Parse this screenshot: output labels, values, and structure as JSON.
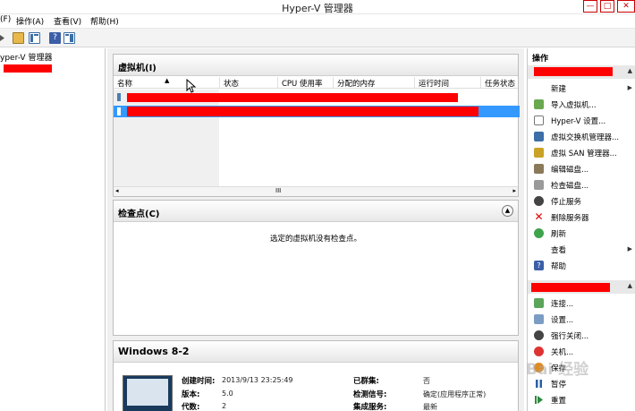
{
  "window": {
    "title": "Hyper-V 管理器",
    "controls": [
      "—",
      "□",
      "✕"
    ]
  },
  "menu": [
    "(F)",
    "操作(A)",
    "查看(V)",
    "帮助(H)"
  ],
  "tree": {
    "root_label": "yper-V 管理器"
  },
  "vm_panel": {
    "title": "虚拟机(I)",
    "columns": [
      "名称",
      "状态",
      "CPU 使用率",
      "分配的内存",
      "运行时间",
      "任务状态"
    ],
    "scroll_mark": "III"
  },
  "checkpoint_panel": {
    "title": "检查点(C)",
    "empty_message": "选定的虚拟机没有检查点。"
  },
  "details_panel": {
    "title": "Windows 8-2",
    "left_fields": [
      {
        "label": "创建时间:",
        "value": "2013/9/13 23:25:49"
      },
      {
        "label": "版本:",
        "value": "5.0"
      },
      {
        "label": "代数:",
        "value": "2"
      }
    ],
    "right_fields": [
      {
        "label": "已群集:",
        "value": "否"
      },
      {
        "label": "检测信号:",
        "value": "确定(应用程序正常)"
      },
      {
        "label": "集成服务:",
        "value": "最新"
      }
    ]
  },
  "actions_pane": {
    "header": "操作",
    "host_items": [
      {
        "label": "新建",
        "icon": "none",
        "submenu": true
      },
      {
        "label": "导入虚拟机...",
        "icon": "import-icon"
      },
      {
        "label": "Hyper-V 设置...",
        "icon": "settings-doc-icon"
      },
      {
        "label": "虚拟交换机管理器...",
        "icon": "switch-icon"
      },
      {
        "label": "虚拟 SAN 管理器...",
        "icon": "san-icon"
      },
      {
        "label": "编辑磁盘...",
        "icon": "edit-disk-icon"
      },
      {
        "label": "检查磁盘...",
        "icon": "inspect-disk-icon"
      },
      {
        "label": "停止服务",
        "icon": "stop-icon"
      },
      {
        "label": "删除服务器",
        "icon": "delete-icon"
      },
      {
        "label": "刷新",
        "icon": "refresh-icon"
      },
      {
        "label": "查看",
        "icon": "none",
        "submenu": true
      },
      {
        "label": "帮助",
        "icon": "help-icon"
      }
    ],
    "vm_items": [
      {
        "label": "连接...",
        "icon": "connect-icon"
      },
      {
        "label": "设置...",
        "icon": "settings-icon"
      },
      {
        "label": "强行关闭...",
        "icon": "turn-off-icon"
      },
      {
        "label": "关机...",
        "icon": "shutdown-icon"
      },
      {
        "label": "保存",
        "icon": "save-icon"
      },
      {
        "label": "暂停",
        "icon": "pause-icon"
      },
      {
        "label": "重置",
        "icon": "reset-icon"
      }
    ]
  },
  "watermark": "Bai 经验"
}
